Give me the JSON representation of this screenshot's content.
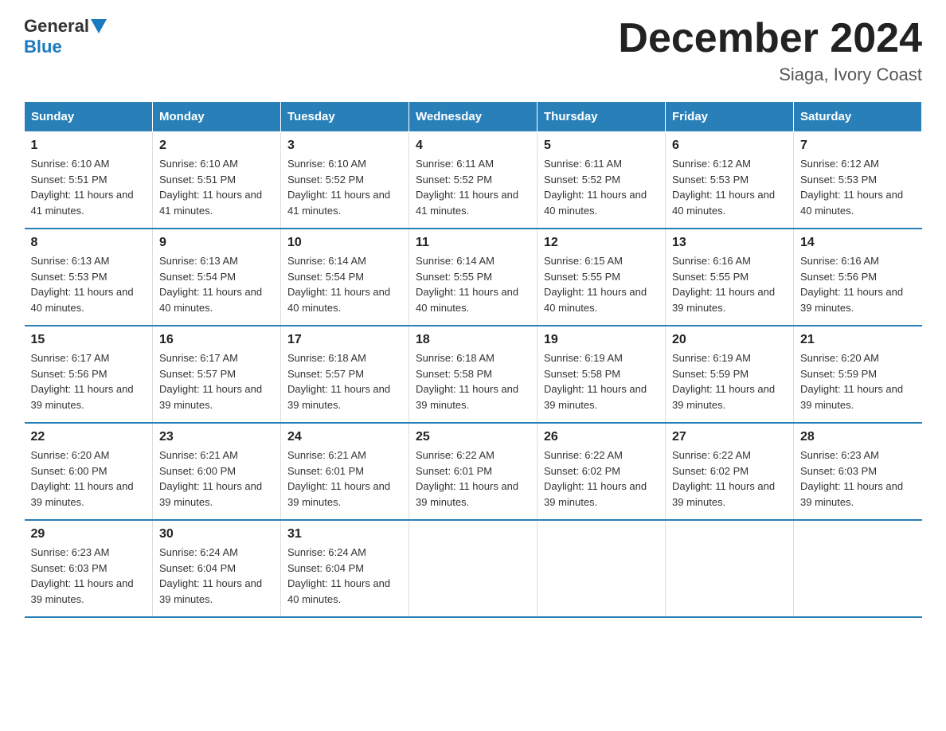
{
  "logo": {
    "general": "General",
    "blue": "Blue"
  },
  "title": "December 2024",
  "subtitle": "Siaga, Ivory Coast",
  "days_of_week": [
    "Sunday",
    "Monday",
    "Tuesday",
    "Wednesday",
    "Thursday",
    "Friday",
    "Saturday"
  ],
  "weeks": [
    [
      {
        "day": "1",
        "sunrise": "6:10 AM",
        "sunset": "5:51 PM",
        "daylight": "11 hours and 41 minutes."
      },
      {
        "day": "2",
        "sunrise": "6:10 AM",
        "sunset": "5:51 PM",
        "daylight": "11 hours and 41 minutes."
      },
      {
        "day": "3",
        "sunrise": "6:10 AM",
        "sunset": "5:52 PM",
        "daylight": "11 hours and 41 minutes."
      },
      {
        "day": "4",
        "sunrise": "6:11 AM",
        "sunset": "5:52 PM",
        "daylight": "11 hours and 41 minutes."
      },
      {
        "day": "5",
        "sunrise": "6:11 AM",
        "sunset": "5:52 PM",
        "daylight": "11 hours and 40 minutes."
      },
      {
        "day": "6",
        "sunrise": "6:12 AM",
        "sunset": "5:53 PM",
        "daylight": "11 hours and 40 minutes."
      },
      {
        "day": "7",
        "sunrise": "6:12 AM",
        "sunset": "5:53 PM",
        "daylight": "11 hours and 40 minutes."
      }
    ],
    [
      {
        "day": "8",
        "sunrise": "6:13 AM",
        "sunset": "5:53 PM",
        "daylight": "11 hours and 40 minutes."
      },
      {
        "day": "9",
        "sunrise": "6:13 AM",
        "sunset": "5:54 PM",
        "daylight": "11 hours and 40 minutes."
      },
      {
        "day": "10",
        "sunrise": "6:14 AM",
        "sunset": "5:54 PM",
        "daylight": "11 hours and 40 minutes."
      },
      {
        "day": "11",
        "sunrise": "6:14 AM",
        "sunset": "5:55 PM",
        "daylight": "11 hours and 40 minutes."
      },
      {
        "day": "12",
        "sunrise": "6:15 AM",
        "sunset": "5:55 PM",
        "daylight": "11 hours and 40 minutes."
      },
      {
        "day": "13",
        "sunrise": "6:16 AM",
        "sunset": "5:55 PM",
        "daylight": "11 hours and 39 minutes."
      },
      {
        "day": "14",
        "sunrise": "6:16 AM",
        "sunset": "5:56 PM",
        "daylight": "11 hours and 39 minutes."
      }
    ],
    [
      {
        "day": "15",
        "sunrise": "6:17 AM",
        "sunset": "5:56 PM",
        "daylight": "11 hours and 39 minutes."
      },
      {
        "day": "16",
        "sunrise": "6:17 AM",
        "sunset": "5:57 PM",
        "daylight": "11 hours and 39 minutes."
      },
      {
        "day": "17",
        "sunrise": "6:18 AM",
        "sunset": "5:57 PM",
        "daylight": "11 hours and 39 minutes."
      },
      {
        "day": "18",
        "sunrise": "6:18 AM",
        "sunset": "5:58 PM",
        "daylight": "11 hours and 39 minutes."
      },
      {
        "day": "19",
        "sunrise": "6:19 AM",
        "sunset": "5:58 PM",
        "daylight": "11 hours and 39 minutes."
      },
      {
        "day": "20",
        "sunrise": "6:19 AM",
        "sunset": "5:59 PM",
        "daylight": "11 hours and 39 minutes."
      },
      {
        "day": "21",
        "sunrise": "6:20 AM",
        "sunset": "5:59 PM",
        "daylight": "11 hours and 39 minutes."
      }
    ],
    [
      {
        "day": "22",
        "sunrise": "6:20 AM",
        "sunset": "6:00 PM",
        "daylight": "11 hours and 39 minutes."
      },
      {
        "day": "23",
        "sunrise": "6:21 AM",
        "sunset": "6:00 PM",
        "daylight": "11 hours and 39 minutes."
      },
      {
        "day": "24",
        "sunrise": "6:21 AM",
        "sunset": "6:01 PM",
        "daylight": "11 hours and 39 minutes."
      },
      {
        "day": "25",
        "sunrise": "6:22 AM",
        "sunset": "6:01 PM",
        "daylight": "11 hours and 39 minutes."
      },
      {
        "day": "26",
        "sunrise": "6:22 AM",
        "sunset": "6:02 PM",
        "daylight": "11 hours and 39 minutes."
      },
      {
        "day": "27",
        "sunrise": "6:22 AM",
        "sunset": "6:02 PM",
        "daylight": "11 hours and 39 minutes."
      },
      {
        "day": "28",
        "sunrise": "6:23 AM",
        "sunset": "6:03 PM",
        "daylight": "11 hours and 39 minutes."
      }
    ],
    [
      {
        "day": "29",
        "sunrise": "6:23 AM",
        "sunset": "6:03 PM",
        "daylight": "11 hours and 39 minutes."
      },
      {
        "day": "30",
        "sunrise": "6:24 AM",
        "sunset": "6:04 PM",
        "daylight": "11 hours and 39 minutes."
      },
      {
        "day": "31",
        "sunrise": "6:24 AM",
        "sunset": "6:04 PM",
        "daylight": "11 hours and 40 minutes."
      },
      null,
      null,
      null,
      null
    ]
  ],
  "labels": {
    "sunrise": "Sunrise:",
    "sunset": "Sunset:",
    "daylight": "Daylight:"
  }
}
